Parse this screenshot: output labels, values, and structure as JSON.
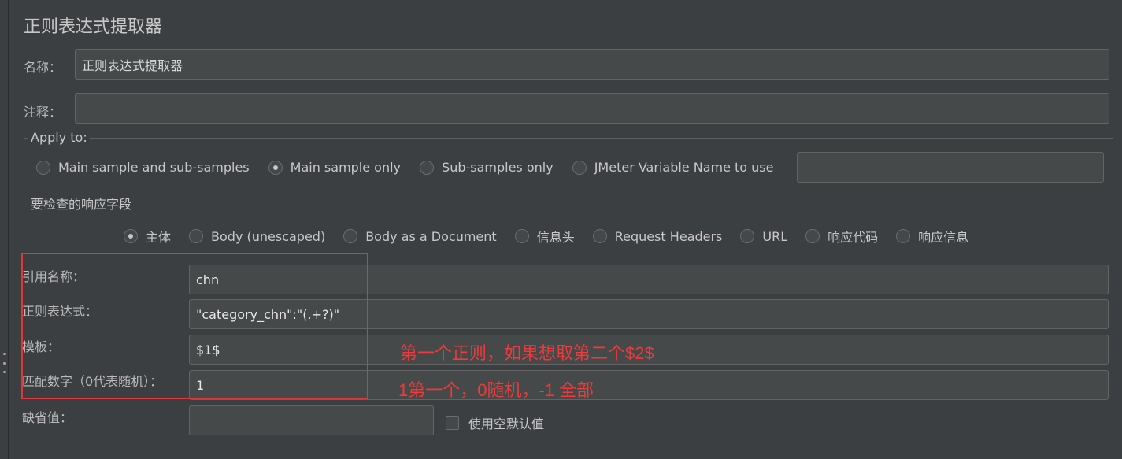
{
  "panel": {
    "title": "正则表达式提取器"
  },
  "name_field": {
    "label": "名称：",
    "value": "正则表达式提取器"
  },
  "comment_field": {
    "label": "注释：",
    "value": ""
  },
  "apply_to": {
    "legend": "Apply to:",
    "options": [
      {
        "label": "Main sample and sub-samples",
        "selected": false
      },
      {
        "label": "Main sample only",
        "selected": true
      },
      {
        "label": "Sub-samples only",
        "selected": false
      },
      {
        "label": "JMeter Variable Name to use",
        "selected": false
      }
    ],
    "variable_value": ""
  },
  "response_field": {
    "legend": "要检查的响应字段",
    "options": [
      {
        "label": "主体",
        "selected": true
      },
      {
        "label": "Body (unescaped)",
        "selected": false
      },
      {
        "label": "Body as a Document",
        "selected": false
      },
      {
        "label": "信息头",
        "selected": false
      },
      {
        "label": "Request Headers",
        "selected": false
      },
      {
        "label": "URL",
        "selected": false
      },
      {
        "label": "响应代码",
        "selected": false
      },
      {
        "label": "响应信息",
        "selected": false
      }
    ]
  },
  "form": {
    "ref_name": {
      "label": "引用名称：",
      "value": "chn"
    },
    "regex": {
      "label": "正则表达式：",
      "value": "\"category_chn\":\"(.+?)\""
    },
    "template": {
      "label": "模板：",
      "value": "$1$"
    },
    "match_no": {
      "label": "匹配数字（0代表随机）：",
      "value": "1"
    },
    "default_value": {
      "label": "缺省值：",
      "value": ""
    },
    "use_empty_default": {
      "label": "使用空默认值",
      "checked": false
    }
  },
  "annotations": {
    "template_note": "第一个正则，如果想取第二个$2$",
    "match_note": "1第一个，0随机，-1 全部",
    "color": "#f0393b"
  }
}
